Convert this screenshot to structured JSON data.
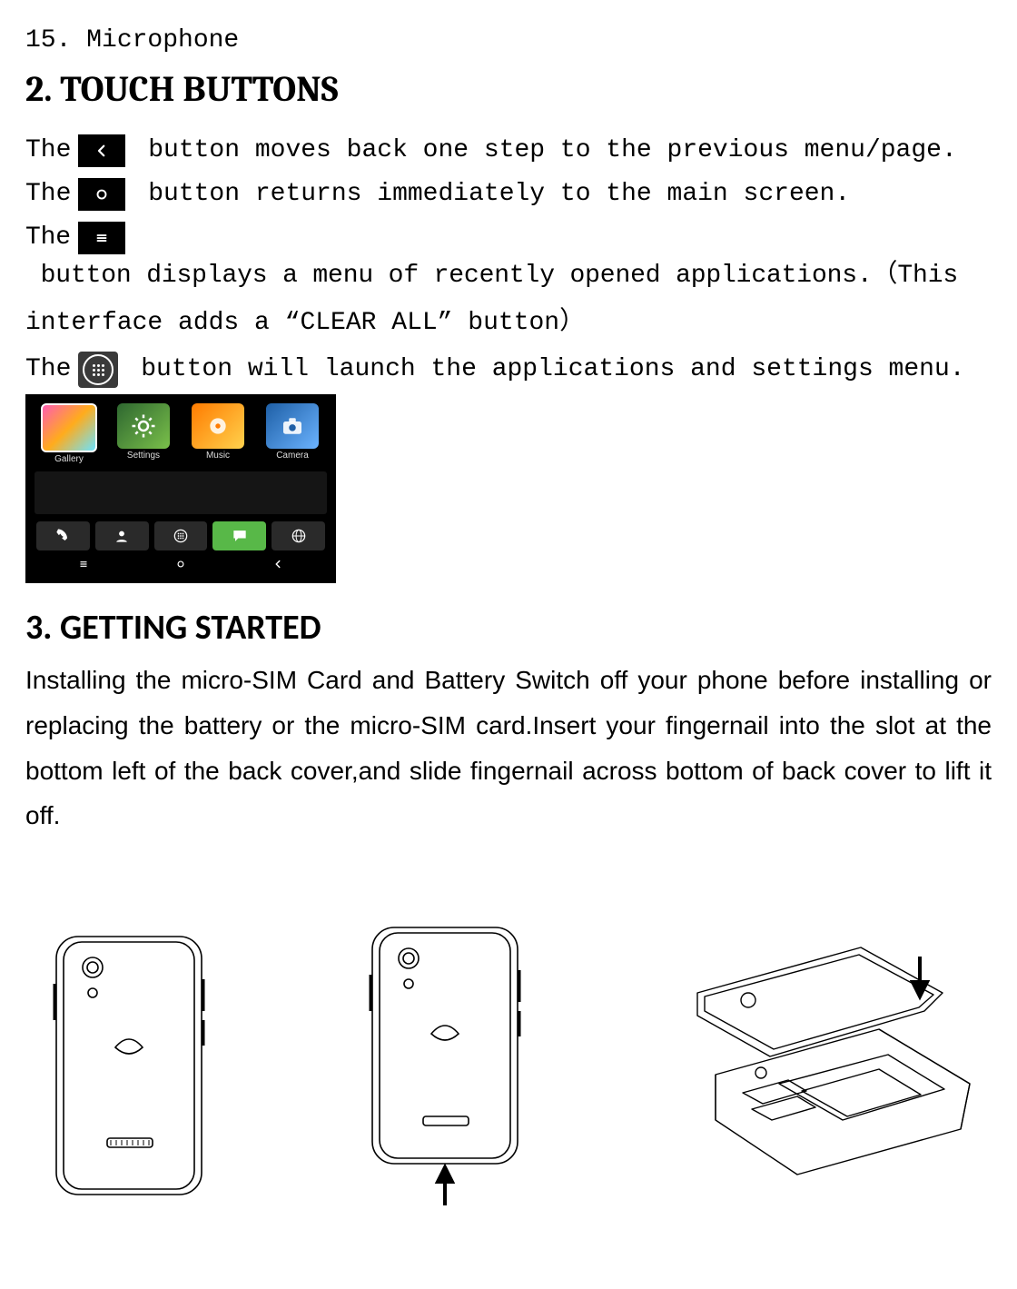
{
  "list_item": "15. Microphone",
  "heading_touch": "2. TOUCH BUTTONS",
  "lines": {
    "l1_pre": "The",
    "l1_post": " button moves back one step to the previous menu/page.",
    "l2_pre": "The",
    "l2_post": " button returns immediately to the main screen.",
    "l3_pre": "The",
    "l3_post_a": " button displays a menu of recently opened applications.（This",
    "l3_b": "interface adds a “CLEAR ALL” button）",
    "l4_pre": "The",
    "l4_post": " button will launch the applications and settings menu."
  },
  "phone": {
    "apps": {
      "gallery": "Gallery",
      "settings": "Settings",
      "music": "Music",
      "camera": "Camera"
    }
  },
  "heading_started": "3. GETTING STARTED",
  "para_started": "Installing the micro-SIM Card and Battery Switch off your phone before installing or replacing the battery or the micro-SIM card.Insert your fingernail into the slot at the bottom left of the back cover,and slide fingernail across bottom of back cover to lift it off."
}
